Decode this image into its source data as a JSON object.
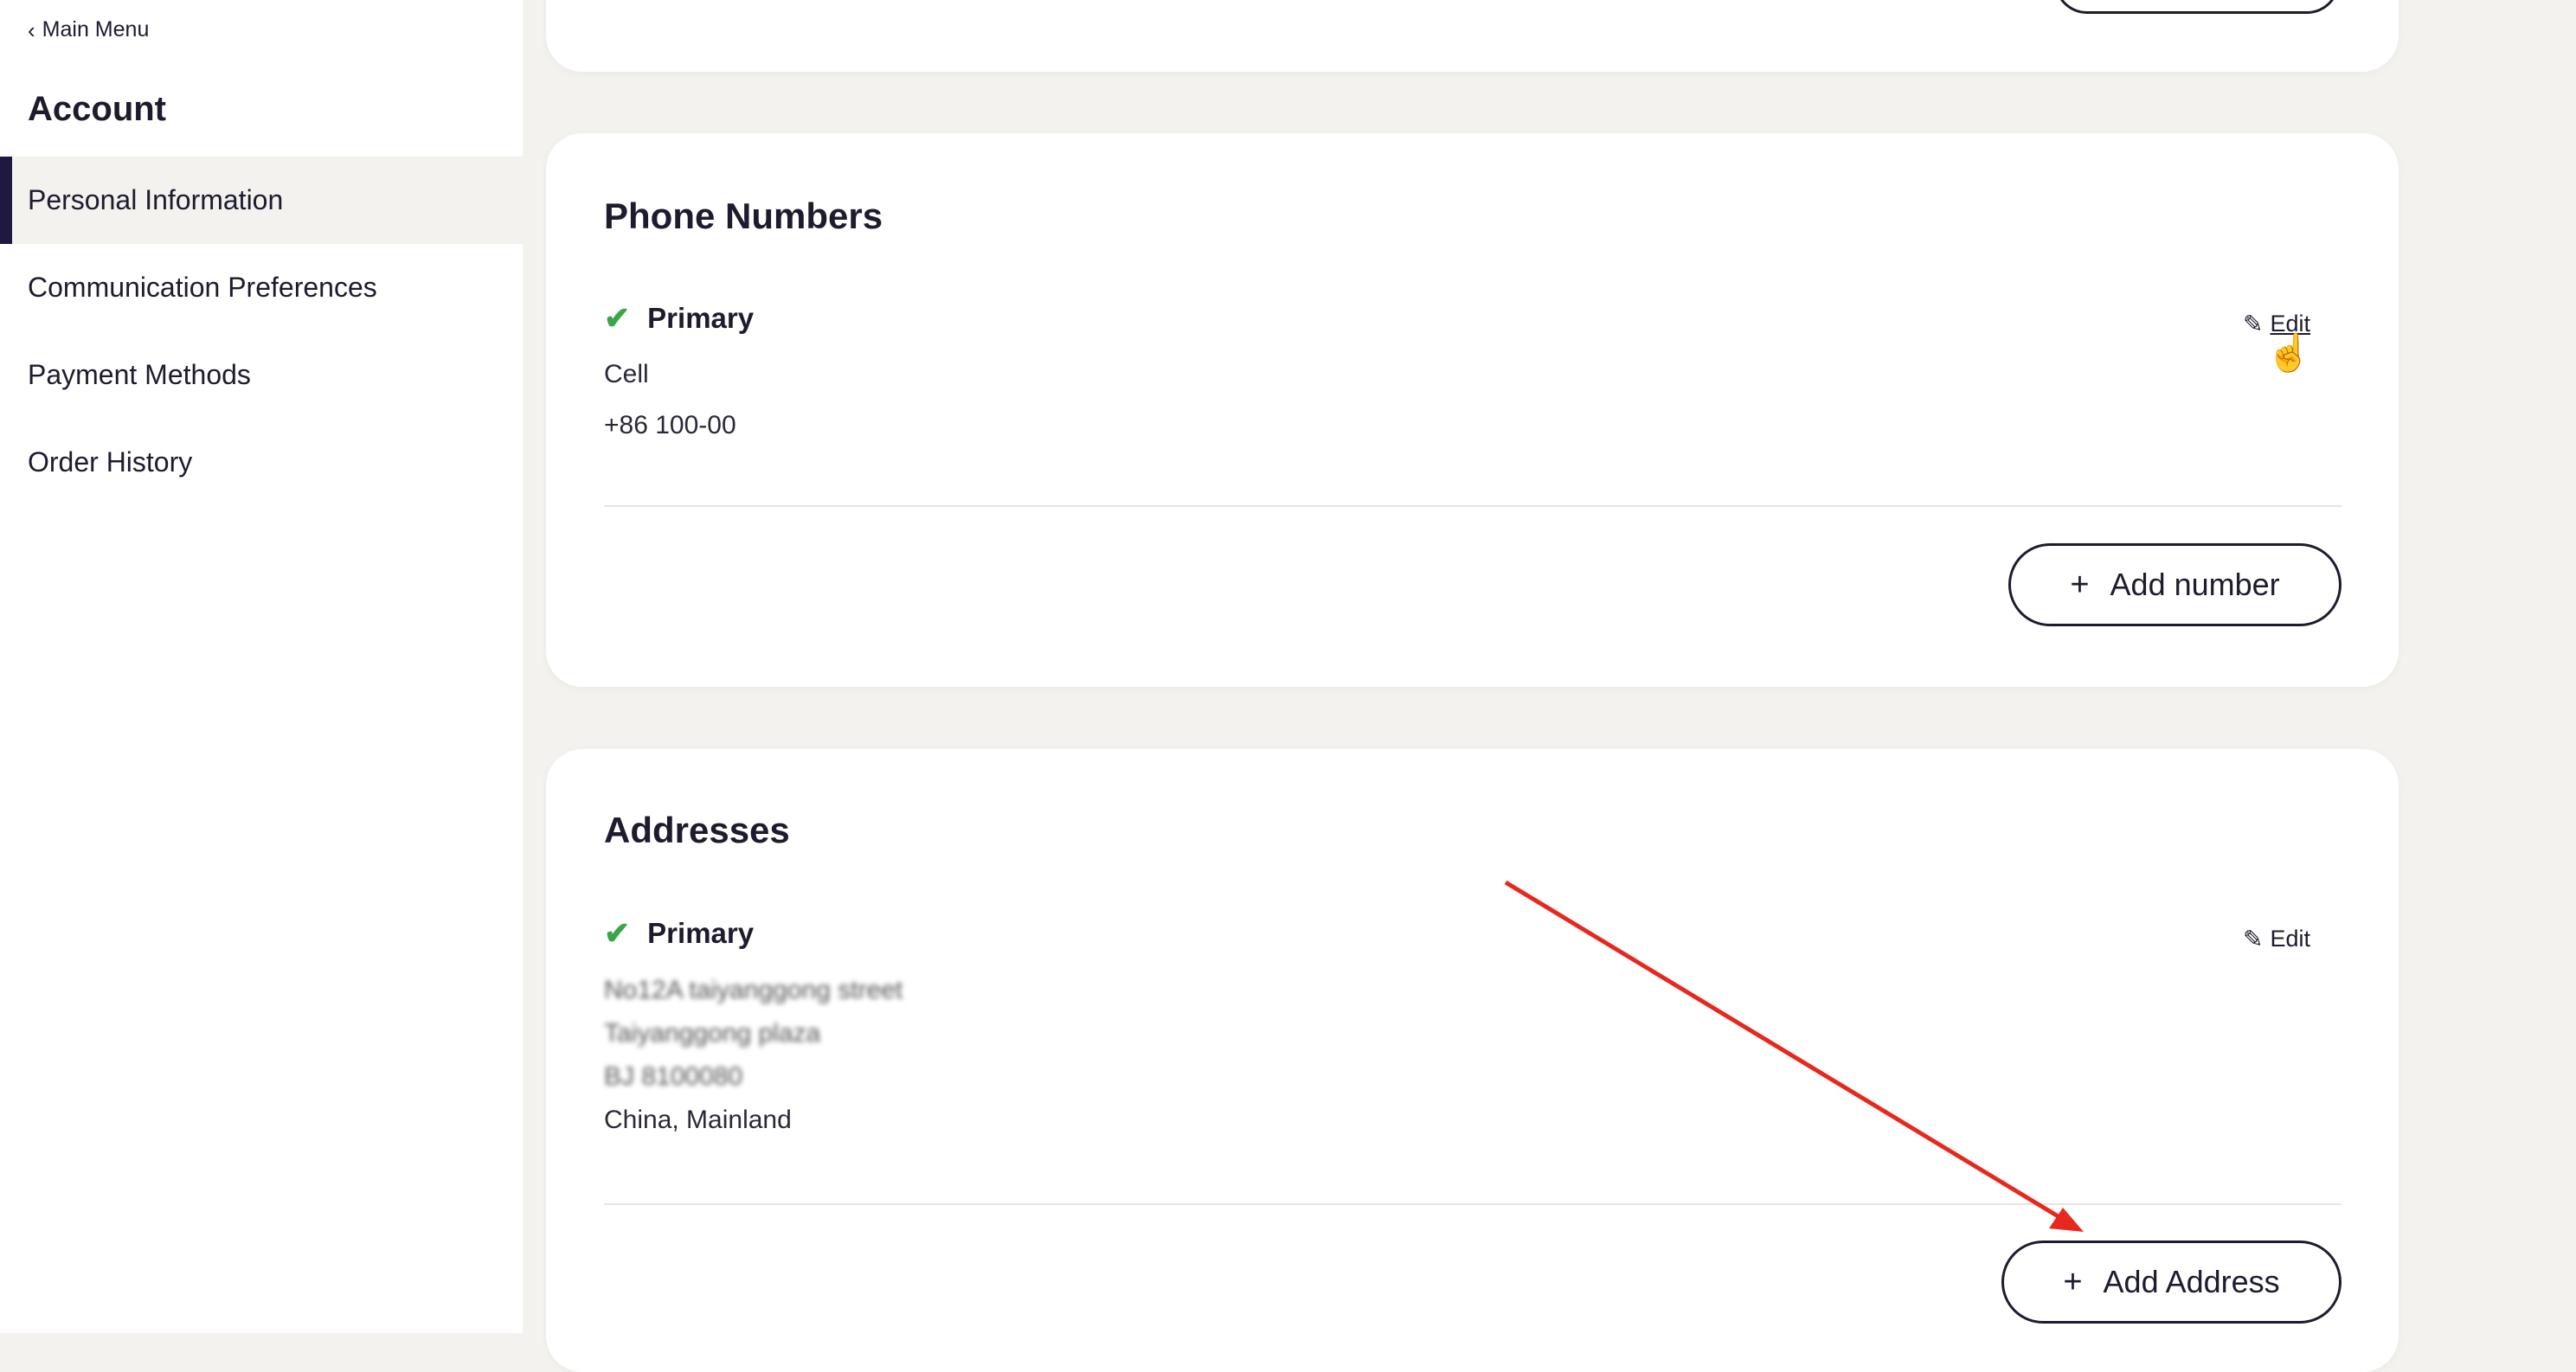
{
  "sidebar": {
    "main_menu": "Main Menu",
    "title": "Account",
    "items": [
      {
        "label": "Personal Information"
      },
      {
        "label": "Communication Preferences"
      },
      {
        "label": "Payment Methods"
      },
      {
        "label": "Order History"
      }
    ]
  },
  "phone": {
    "title": "Phone Numbers",
    "primary_label": "Primary",
    "type": "Cell",
    "number": "+86 100-00",
    "edit_label": "Edit",
    "add_label": "Add number"
  },
  "address": {
    "title": "Addresses",
    "primary_label": "Primary",
    "line1": "No12A taiyanggong street",
    "line2": "Taiyanggong plaza",
    "line3": "BJ 8100080",
    "line4": "China, Mainland",
    "edit_label": "Edit",
    "add_label": "Add Address"
  },
  "colors": {
    "accent": "#1f1840",
    "check": "#3aa64a",
    "annotation_arrow": "#e8281e",
    "background": "#f3f2ef"
  },
  "icons": {
    "back": "chevron-left-icon",
    "check": "check-icon",
    "edit": "pencil-icon",
    "add": "plus-icon",
    "cursor": "hand-pointer-icon"
  }
}
